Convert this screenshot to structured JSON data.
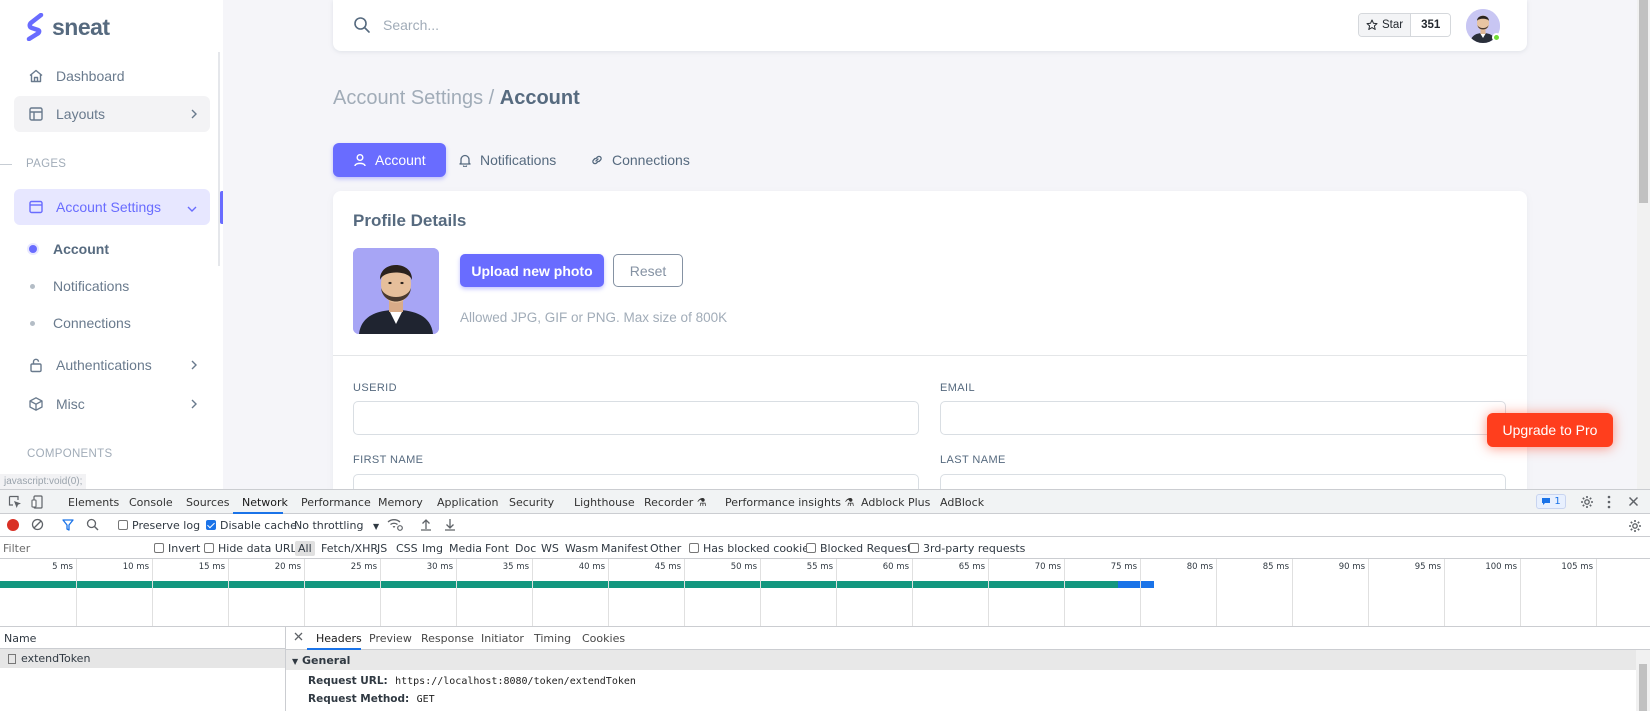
{
  "brand": {
    "name": "sneat"
  },
  "sidebar": {
    "items": [
      {
        "label": "Dashboard",
        "icon": "home-icon"
      },
      {
        "label": "Layouts",
        "icon": "layout-icon"
      }
    ],
    "pages_header": "PAGES",
    "account_settings": {
      "label": "Account Settings",
      "icon": "window-icon"
    },
    "sub_items": [
      {
        "label": "Account",
        "active": true
      },
      {
        "label": "Notifications",
        "active": false
      },
      {
        "label": "Connections",
        "active": false
      }
    ],
    "more_items": [
      {
        "label": "Authentications",
        "icon": "lock-icon"
      },
      {
        "label": "Misc",
        "icon": "cube-icon"
      }
    ],
    "components_header": "COMPONENTS",
    "status_link": "javascript:void(0);"
  },
  "navbar": {
    "search_placeholder": "Search...",
    "star_label": "Star",
    "star_count": "351"
  },
  "breadcrumb": {
    "parent": "Account Settings /",
    "current": "Account"
  },
  "tabs": [
    {
      "label": "Account",
      "icon": "user-icon",
      "active": true
    },
    {
      "label": "Notifications",
      "icon": "bell-icon",
      "active": false
    },
    {
      "label": "Connections",
      "icon": "link-icon",
      "active": false
    }
  ],
  "profile": {
    "title": "Profile Details",
    "upload_label": "Upload new photo",
    "reset_label": "Reset",
    "hint": "Allowed JPG, GIF or PNG. Max size of 800K"
  },
  "form": {
    "userid_label": "USERID",
    "email_label": "EMAIL",
    "firstname_label": "FIRST NAME",
    "lastname_label": "LAST NAME"
  },
  "upgrade_label": "Upgrade to Pro",
  "devtools": {
    "tabs": [
      "Elements",
      "Console",
      "Sources",
      "Network",
      "Performance",
      "Memory",
      "Application",
      "Security",
      "Lighthouse",
      "Recorder",
      "Performance insights",
      "Adblock Plus",
      "AdBlock"
    ],
    "active_tab": "Network",
    "issues_count": "1",
    "preserve_log": "Preserve log",
    "disable_cache": "Disable cache",
    "throttling": "No throttling",
    "filter_placeholder": "Filter",
    "invert": "Invert",
    "hide_data_urls": "Hide data URLs",
    "type_filters": [
      "All",
      "Fetch/XHR",
      "JS",
      "CSS",
      "Img",
      "Media",
      "Font",
      "Doc",
      "WS",
      "Wasm",
      "Manifest",
      "Other"
    ],
    "has_blocked_cookies": "Has blocked cookies",
    "blocked_requests": "Blocked Requests",
    "third_party": "3rd-party requests",
    "timeline_ticks": [
      "5 ms",
      "10 ms",
      "15 ms",
      "20 ms",
      "25 ms",
      "30 ms",
      "35 ms",
      "40 ms",
      "45 ms",
      "50 ms",
      "55 ms",
      "60 ms",
      "65 ms",
      "70 ms",
      "75 ms",
      "80 ms",
      "85 ms",
      "90 ms",
      "95 ms",
      "100 ms",
      "105 ms"
    ],
    "name_header": "Name",
    "request_name": "extendToken",
    "detail_tabs": [
      "Headers",
      "Preview",
      "Response",
      "Initiator",
      "Timing",
      "Cookies"
    ],
    "general_header": "General",
    "request_url_key": "Request URL:",
    "request_url": "https://localhost:8080/token/extendToken",
    "request_method_key": "Request Method:",
    "request_method": "GET"
  }
}
